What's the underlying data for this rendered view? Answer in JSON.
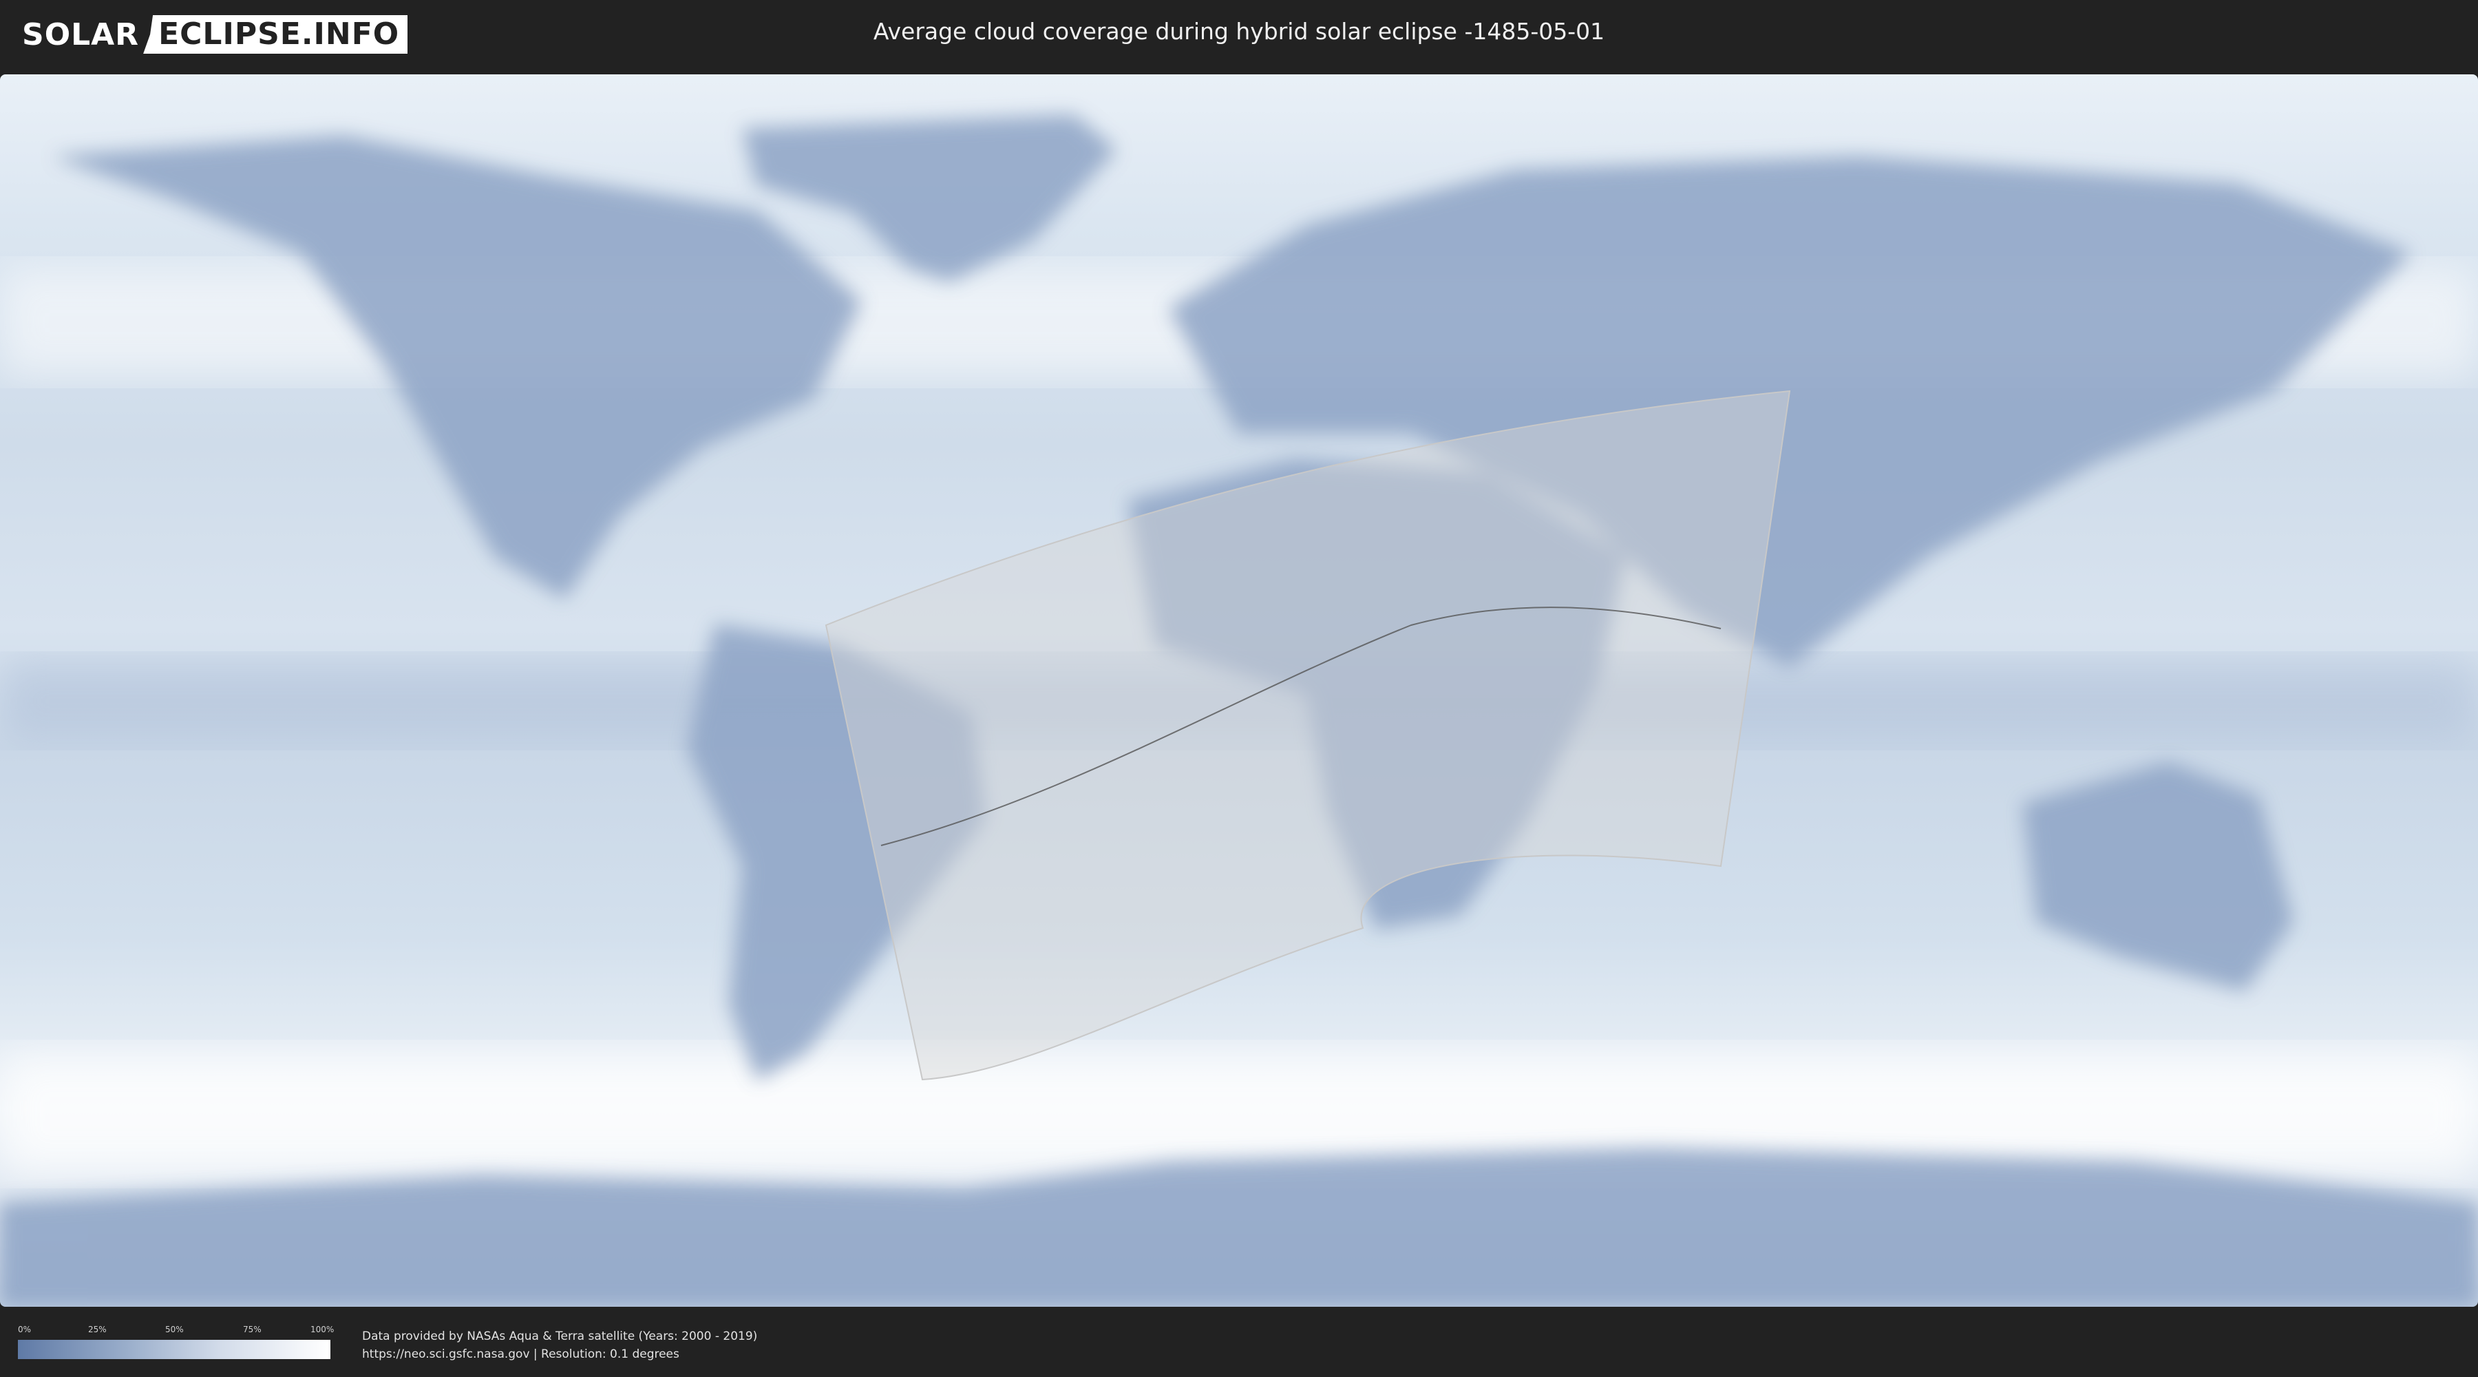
{
  "logo": {
    "part1": "SOLAR",
    "part2": "ECLIPSE.INFO"
  },
  "title": "Average cloud coverage during hybrid solar eclipse -1485-05-01",
  "legend": {
    "ticks": [
      "0%",
      "25%",
      "50%",
      "75%",
      "100%"
    ],
    "colors": {
      "low": "#5f7aa6",
      "high": "#ffffff"
    }
  },
  "credits": {
    "line1": "Data provided by NASAs Aqua & Terra satellite (Years: 2000 - 2019)",
    "line2": "https://neo.sci.gsfc.nasa.gov | Resolution: 0.1 degrees"
  },
  "map": {
    "colors": {
      "ocean_cloudy": "#e6eef6",
      "clear_sky": "#6f88b3",
      "eclipse_zone": "#d8d8d8",
      "central_line": "#555555"
    }
  }
}
